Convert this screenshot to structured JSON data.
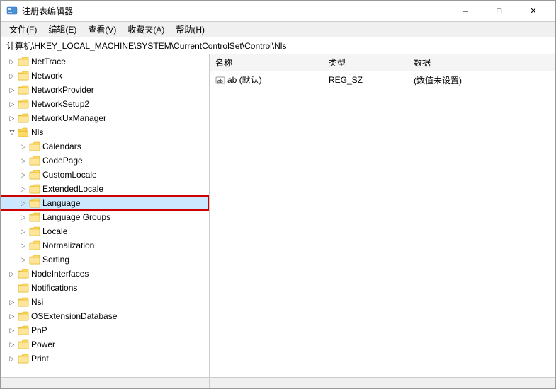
{
  "window": {
    "title": "注册表编辑器",
    "buttons": {
      "minimize": "－",
      "maximize": "□",
      "close": "✕"
    }
  },
  "menu": {
    "items": [
      "文件(F)",
      "编辑(E)",
      "查看(V)",
      "收藏夹(A)",
      "帮助(H)"
    ]
  },
  "address": "计算机\\HKEY_LOCAL_MACHINE\\SYSTEM\\CurrentControlSet\\Control\\Nls",
  "tree": {
    "items": [
      {
        "id": "NetTrace",
        "label": "NetTrace",
        "level": 1,
        "expanded": false,
        "hasChildren": true
      },
      {
        "id": "Network",
        "label": "Network",
        "level": 1,
        "expanded": false,
        "hasChildren": true
      },
      {
        "id": "NetworkProvider",
        "label": "NetworkProvider",
        "level": 1,
        "expanded": false,
        "hasChildren": true
      },
      {
        "id": "NetworkSetup2",
        "label": "NetworkSetup2",
        "level": 1,
        "expanded": false,
        "hasChildren": true
      },
      {
        "id": "NetworkUxManager",
        "label": "NetworkUxManager",
        "level": 1,
        "expanded": false,
        "hasChildren": true
      },
      {
        "id": "Nls",
        "label": "Nls",
        "level": 1,
        "expanded": true,
        "hasChildren": true,
        "selected": false
      },
      {
        "id": "Calendars",
        "label": "Calendars",
        "level": 2,
        "expanded": false,
        "hasChildren": true
      },
      {
        "id": "CodePage",
        "label": "CodePage",
        "level": 2,
        "expanded": false,
        "hasChildren": true
      },
      {
        "id": "CustomLocale",
        "label": "CustomLocale",
        "level": 2,
        "expanded": false,
        "hasChildren": true
      },
      {
        "id": "ExtendedLocale",
        "label": "ExtendedLocale",
        "level": 2,
        "expanded": false,
        "hasChildren": true
      },
      {
        "id": "Language",
        "label": "Language",
        "level": 2,
        "expanded": false,
        "hasChildren": true,
        "highlighted": true,
        "selected": true
      },
      {
        "id": "LanguageGroups",
        "label": "Language Groups",
        "level": 2,
        "expanded": false,
        "hasChildren": true
      },
      {
        "id": "Locale",
        "label": "Locale",
        "level": 2,
        "expanded": false,
        "hasChildren": true
      },
      {
        "id": "Normalization",
        "label": "Normalization",
        "level": 2,
        "expanded": false,
        "hasChildren": true
      },
      {
        "id": "Sorting",
        "label": "Sorting",
        "level": 2,
        "expanded": false,
        "hasChildren": true
      },
      {
        "id": "NodeInterfaces",
        "label": "NodeInterfaces",
        "level": 1,
        "expanded": false,
        "hasChildren": true
      },
      {
        "id": "Notifications",
        "label": "Notifications",
        "level": 1,
        "expanded": false,
        "hasChildren": false
      },
      {
        "id": "Nsi",
        "label": "Nsi",
        "level": 1,
        "expanded": false,
        "hasChildren": true
      },
      {
        "id": "OSExtensionDatabase",
        "label": "OSExtensionDatabase",
        "level": 1,
        "expanded": false,
        "hasChildren": true
      },
      {
        "id": "PnP",
        "label": "PnP",
        "level": 1,
        "expanded": false,
        "hasChildren": true
      },
      {
        "id": "Power",
        "label": "Power",
        "level": 1,
        "expanded": false,
        "hasChildren": true
      },
      {
        "id": "Print",
        "label": "Print",
        "level": 1,
        "expanded": false,
        "hasChildren": true
      }
    ]
  },
  "table": {
    "columns": [
      "名称",
      "类型",
      "数据"
    ],
    "rows": [
      {
        "name": "ab (默认)",
        "type": "REG_SZ",
        "data": "(数值未设置)"
      }
    ]
  }
}
